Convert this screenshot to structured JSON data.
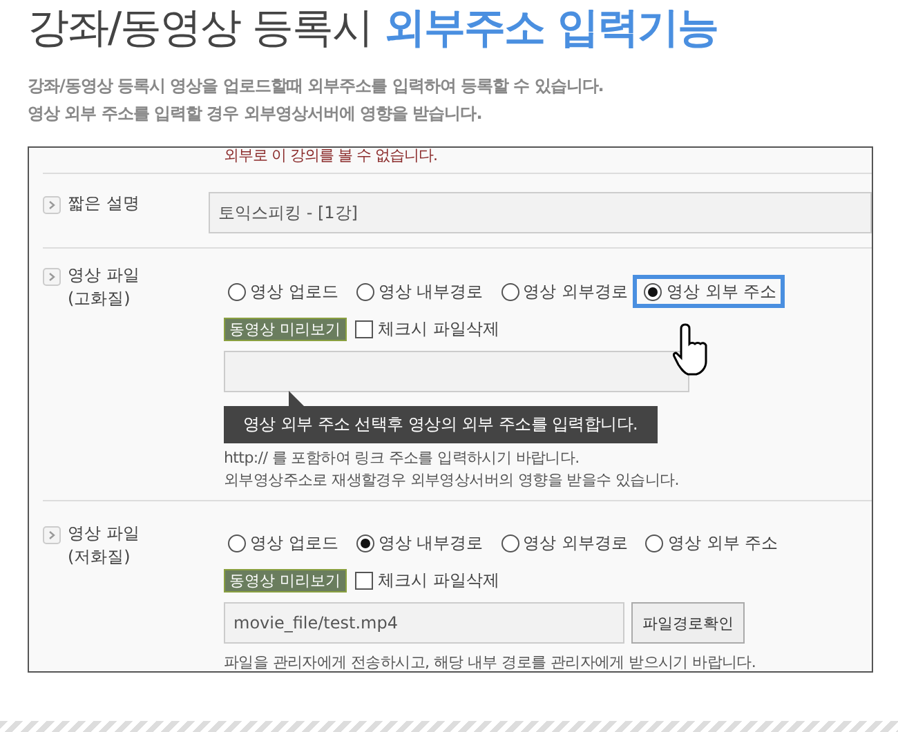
{
  "title": {
    "plain": "강좌/동영상 등록시 ",
    "highlight": "외부주소 입력기능"
  },
  "description": [
    "강좌/동영상 등록시 영상을 업로드할때 외부주소를 입력하여 등록할 수 있습니다.",
    "영상 외부 주소를 입력할 경우 외부영상서버에 영향을 받습니다."
  ],
  "form": {
    "notice": "외부로 이 강의를 볼 수 없습니다.",
    "rows": [
      {
        "kind": "text",
        "label": [
          "짧은 설명"
        ],
        "value": "토익스피킹 - [1강]"
      },
      {
        "kind": "video",
        "label": [
          "영상 파일",
          "(고화질)"
        ],
        "options": [
          {
            "label": "영상 업로드",
            "selected": false,
            "highlighted": false
          },
          {
            "label": "영상 내부경로",
            "selected": false,
            "highlighted": false
          },
          {
            "label": "영상 외부경로",
            "selected": false,
            "highlighted": false
          },
          {
            "label": "영상 외부 주소",
            "selected": true,
            "highlighted": true
          }
        ],
        "preview_button": "동영상 미리보기",
        "delete_checkbox": {
          "label": "체크시 파일삭제",
          "checked": false
        },
        "tooltip": "영상 외부 주소 선택후 영상의 외부 주소를 입력합니다.",
        "help": [
          "http:// 를 포함하여 링크 주소를 입력하시기 바랍니다.",
          "외부영상주소로 재생할경우 외부영상서버의 영향을 받을수 있습니다."
        ]
      },
      {
        "kind": "video",
        "label": [
          "영상 파일",
          "(저화질)"
        ],
        "options": [
          {
            "label": "영상 업로드",
            "selected": false,
            "highlighted": false
          },
          {
            "label": "영상 내부경로",
            "selected": true,
            "highlighted": false
          },
          {
            "label": "영상 외부경로",
            "selected": false,
            "highlighted": false
          },
          {
            "label": "영상 외부 주소",
            "selected": false,
            "highlighted": false
          }
        ],
        "preview_button": "동영상 미리보기",
        "delete_checkbox": {
          "label": "체크시 파일삭제",
          "checked": false
        },
        "value": "movie_file/test.mp4",
        "path_button": "파일경로확인",
        "help": [
          "파일을 관리자에게 전송하시고, 해당 내부 경로를 관리자에게 받으시기 바랍니다."
        ]
      }
    ]
  }
}
